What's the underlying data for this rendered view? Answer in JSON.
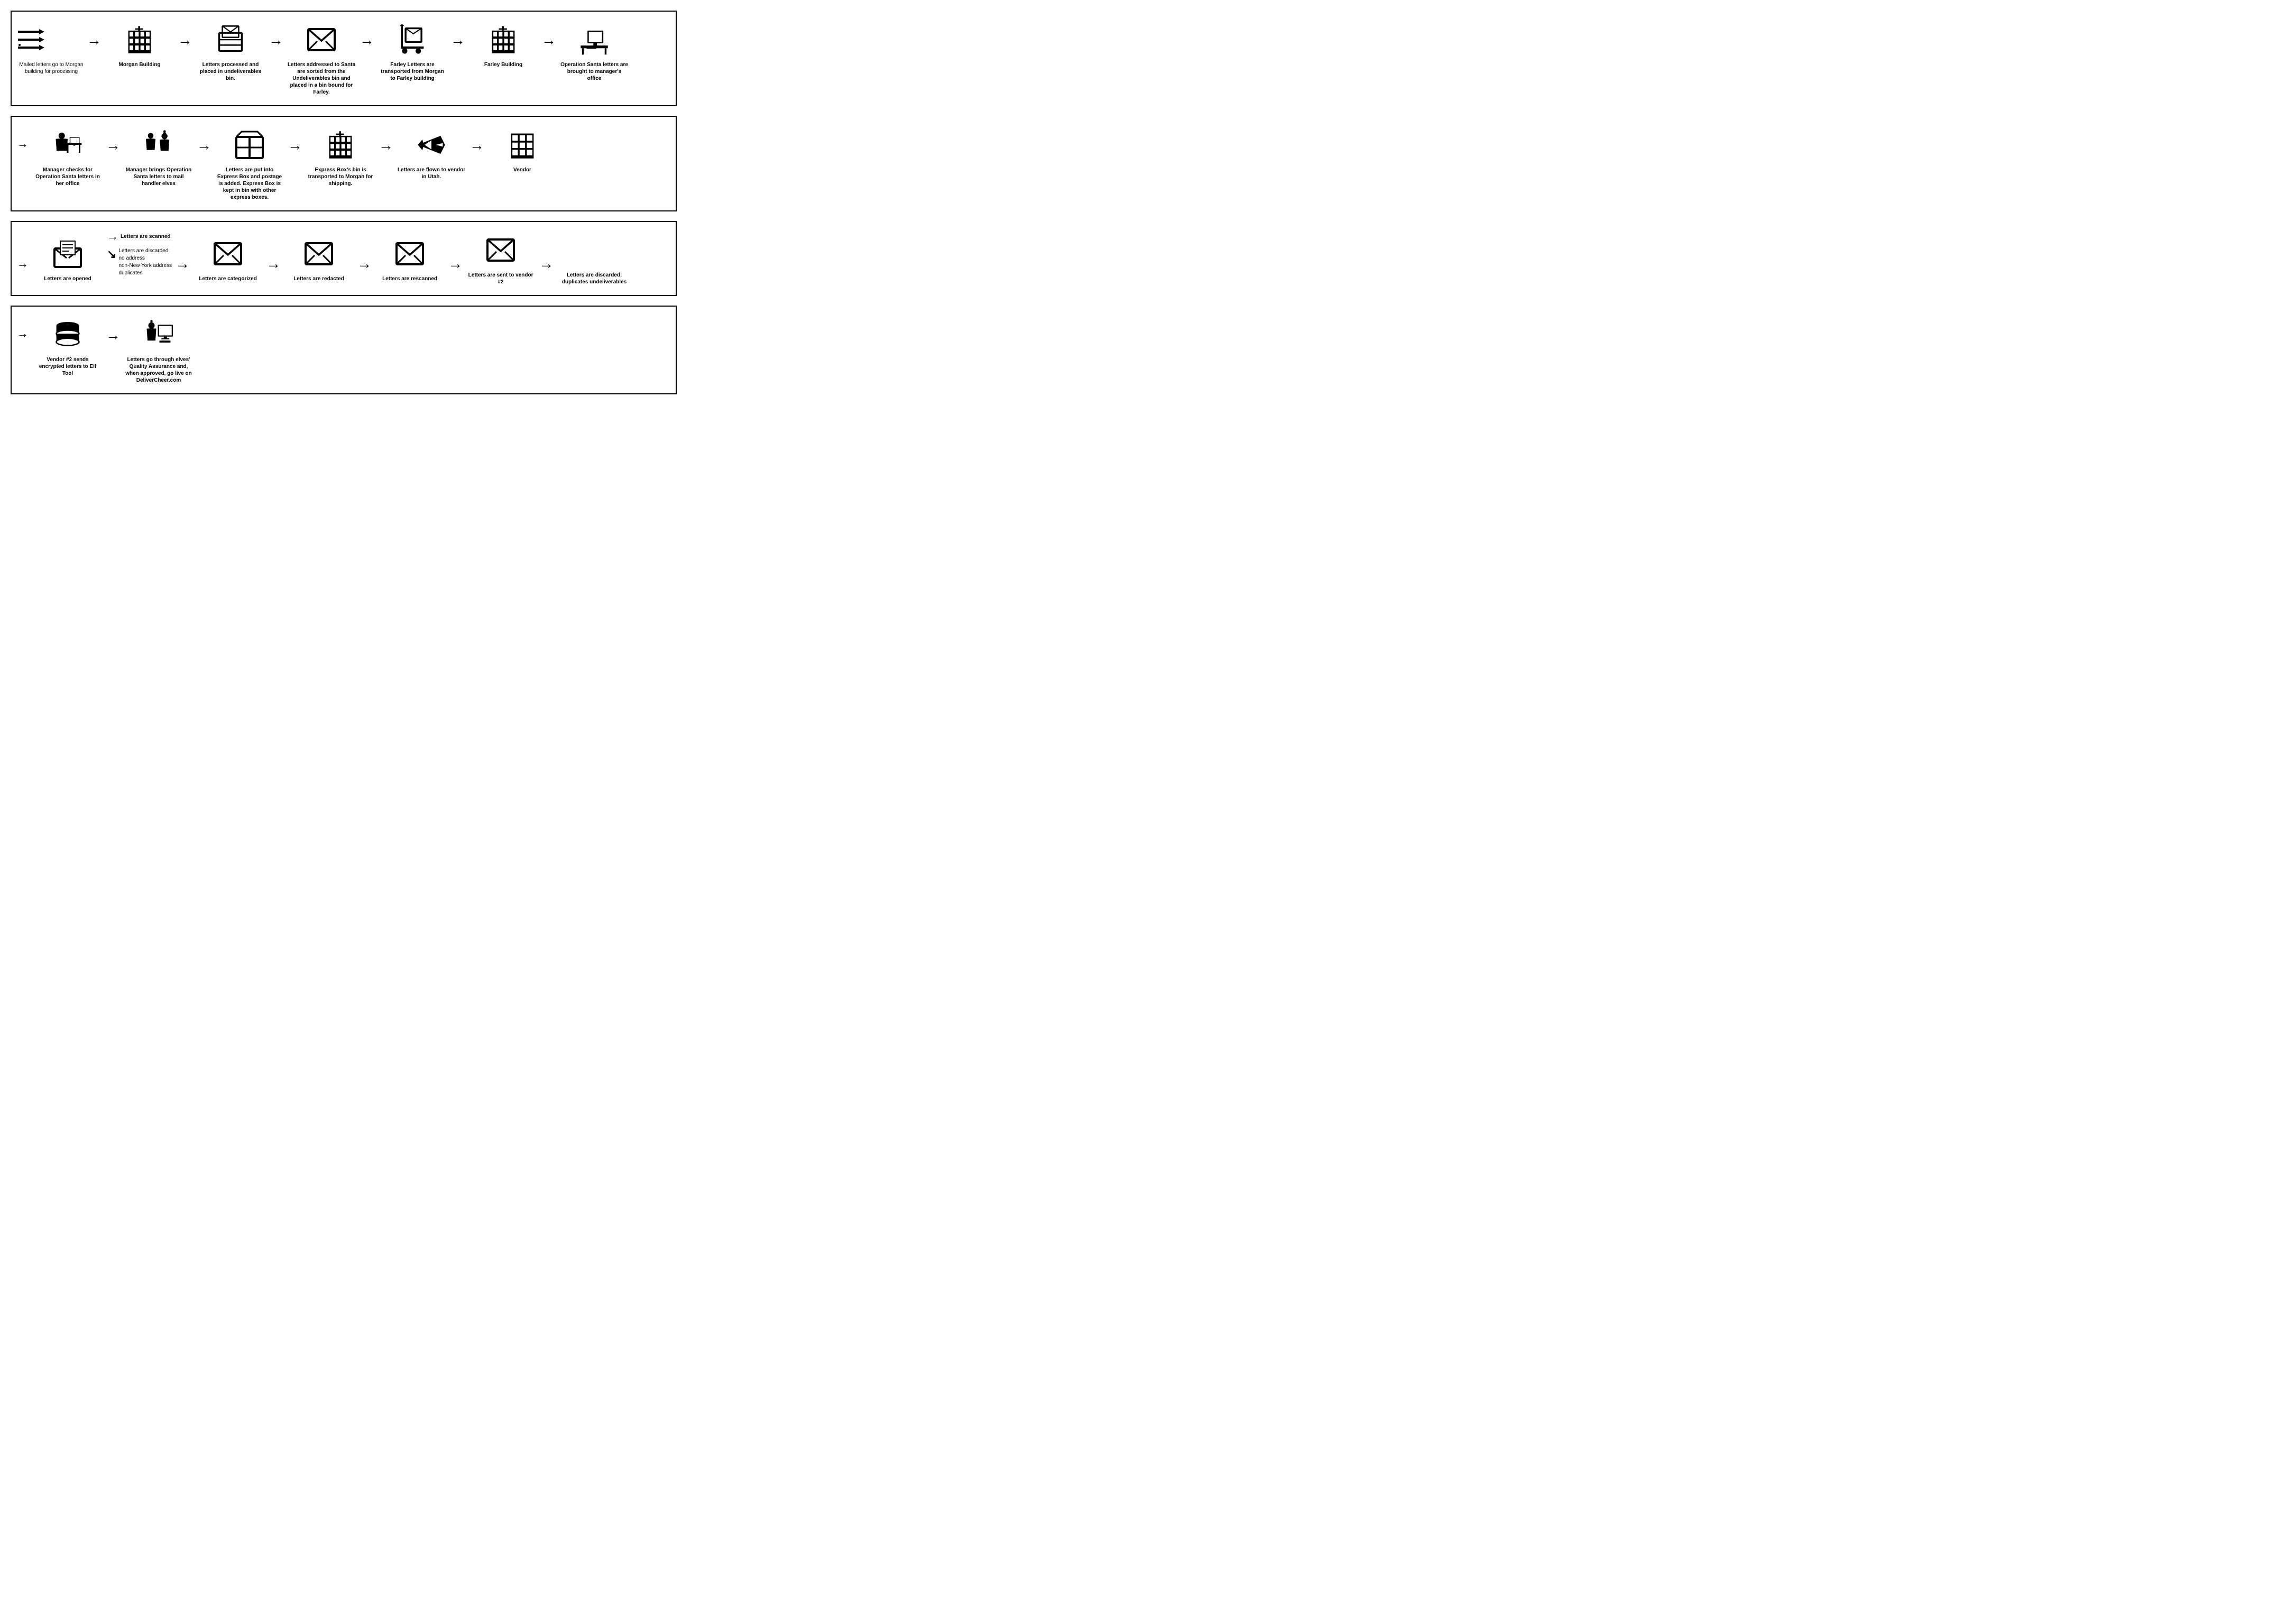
{
  "sections": [
    {
      "id": "section1",
      "items": [
        {
          "type": "start-label",
          "label": "Mailed letters go to Morgan building for processing",
          "icon": "letters-flying"
        },
        {
          "type": "arrow"
        },
        {
          "type": "item",
          "icon": "building",
          "label": "Morgan Building",
          "bold": true
        },
        {
          "type": "arrow"
        },
        {
          "type": "item",
          "icon": "bin",
          "label": "Letters processed and placed in undeliverables bin.",
          "bold": false
        },
        {
          "type": "arrow"
        },
        {
          "type": "item",
          "icon": "envelope-sort",
          "label": "Letters addressed to Santa are sorted from the Undeliverables bin and placed in a bin bound for Farley.",
          "bold": false
        },
        {
          "type": "arrow"
        },
        {
          "type": "item",
          "icon": "cart-letter",
          "label": "Farley Letters are transported from Morgan to Farley building",
          "bold": false
        },
        {
          "type": "arrow"
        },
        {
          "type": "item",
          "icon": "farley-building",
          "label": "Farley Building",
          "bold": true
        },
        {
          "type": "arrow"
        },
        {
          "type": "item",
          "icon": "desk-computer",
          "label": "Operation Santa letters are brought to manager's office",
          "bold": false
        }
      ]
    },
    {
      "id": "section2",
      "items": [
        {
          "type": "item",
          "icon": "manager-desk",
          "label": "Manager checks for Operation Santa letters in her office",
          "bold": false
        },
        {
          "type": "arrow"
        },
        {
          "type": "item",
          "icon": "manager-elf",
          "label": "Manager brings Operation Santa letters to mail handler elves",
          "bold": false
        },
        {
          "type": "arrow"
        },
        {
          "type": "item",
          "icon": "express-box",
          "label": "Letters are put into Express Box and postage is added. Express Box is kept in bin with other express boxes.",
          "bold": false
        },
        {
          "type": "arrow"
        },
        {
          "type": "item",
          "icon": "building2",
          "label": "Express Box's bin is transported to Morgan for shipping.",
          "bold": false
        },
        {
          "type": "arrow"
        },
        {
          "type": "item",
          "icon": "airplane",
          "label": "Letters are flown to vendor in Utah.",
          "bold": false
        },
        {
          "type": "arrow"
        },
        {
          "type": "item",
          "icon": "vendor-building",
          "label": "Vendor",
          "bold": true
        }
      ]
    },
    {
      "id": "section3",
      "items": [
        {
          "type": "item-open",
          "icon": "open-letter",
          "label": "Letters are opened",
          "bold": false
        },
        {
          "type": "branch-arrow"
        },
        {
          "type": "branch",
          "top": "Letters are scanned",
          "bottom": "Letters are discarded:\nno address\nnon-New York address\nduplicates"
        },
        {
          "type": "arrow"
        },
        {
          "type": "item",
          "icon": "envelope-cat",
          "label": "Letters are categorized",
          "bold": false
        },
        {
          "type": "arrow"
        },
        {
          "type": "item",
          "icon": "envelope-redact",
          "label": "Letters are redacted",
          "bold": false
        },
        {
          "type": "arrow"
        },
        {
          "type": "item",
          "icon": "envelope-rescan",
          "label": "Letters are rescanned",
          "bold": false
        },
        {
          "type": "arrow"
        },
        {
          "type": "item",
          "icon": "envelope-send",
          "label": "Letters are sent to vendor #2",
          "bold": false
        },
        {
          "type": "arrow"
        },
        {
          "type": "item",
          "icon": "discard",
          "label": "Letters are discarded: duplicates undeliverables",
          "bold": false
        }
      ]
    },
    {
      "id": "section4",
      "items": [
        {
          "type": "item",
          "icon": "database",
          "label": "Vendor #2 sends encrypted letters to Elf Tool",
          "bold": false
        },
        {
          "type": "arrow"
        },
        {
          "type": "item",
          "icon": "elf-computer",
          "label": "Letters go through elves' Quality Assurance and, when approved, go live on DeliverCheer.com",
          "bold": false
        }
      ]
    }
  ]
}
